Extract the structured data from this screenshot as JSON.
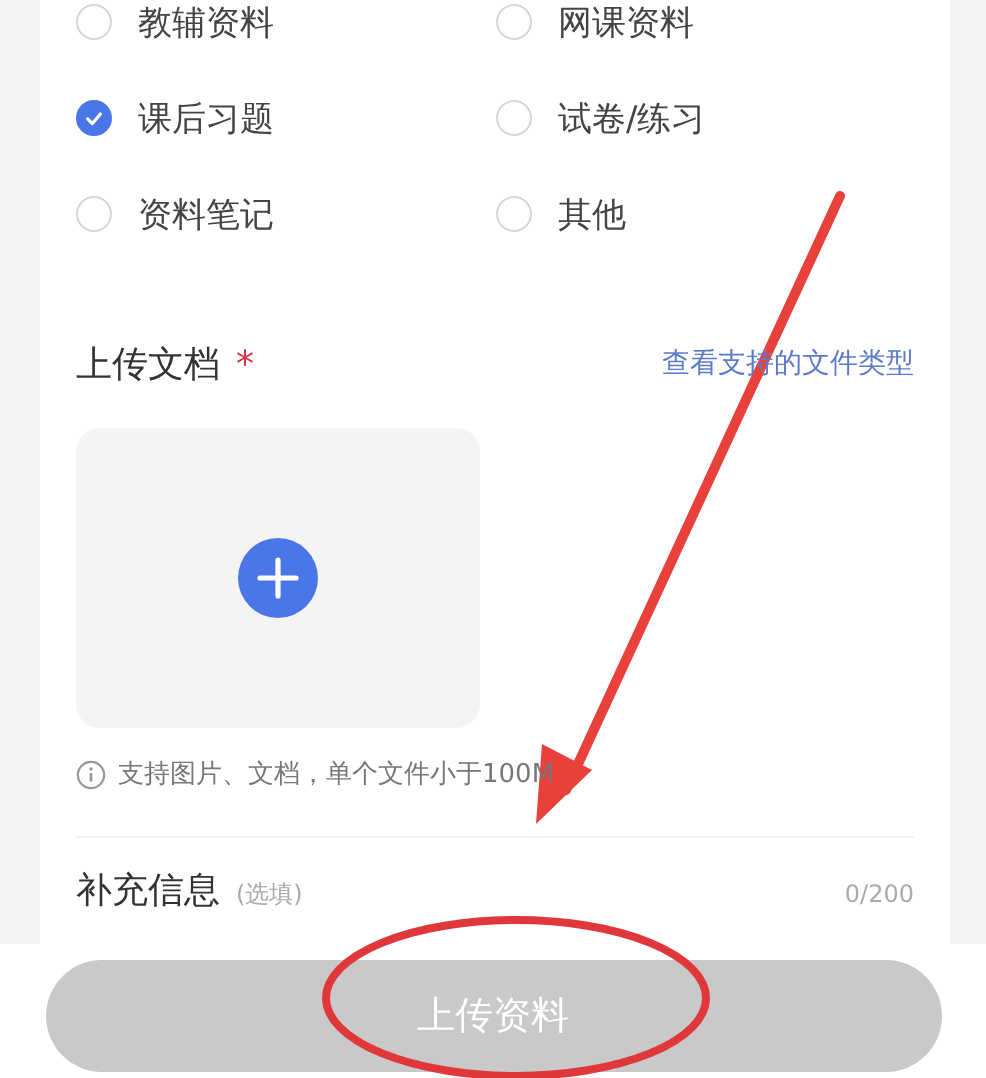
{
  "options": [
    {
      "label": "教辅资料",
      "selected": false
    },
    {
      "label": "网课资料",
      "selected": false
    },
    {
      "label": "课后习题",
      "selected": true
    },
    {
      "label": "试卷/练习",
      "selected": false
    },
    {
      "label": "资料笔记",
      "selected": false
    },
    {
      "label": "其他",
      "selected": false
    }
  ],
  "upload": {
    "title": "上传文档",
    "required": "*",
    "link": "查看支持的文件类型",
    "note": "支持图片、文档，单个文件小于100M"
  },
  "supplement": {
    "title": "补充信息",
    "hint": "(选填)",
    "counter": "0/200"
  },
  "submit": {
    "label": "上传资料",
    "disabled": true
  }
}
